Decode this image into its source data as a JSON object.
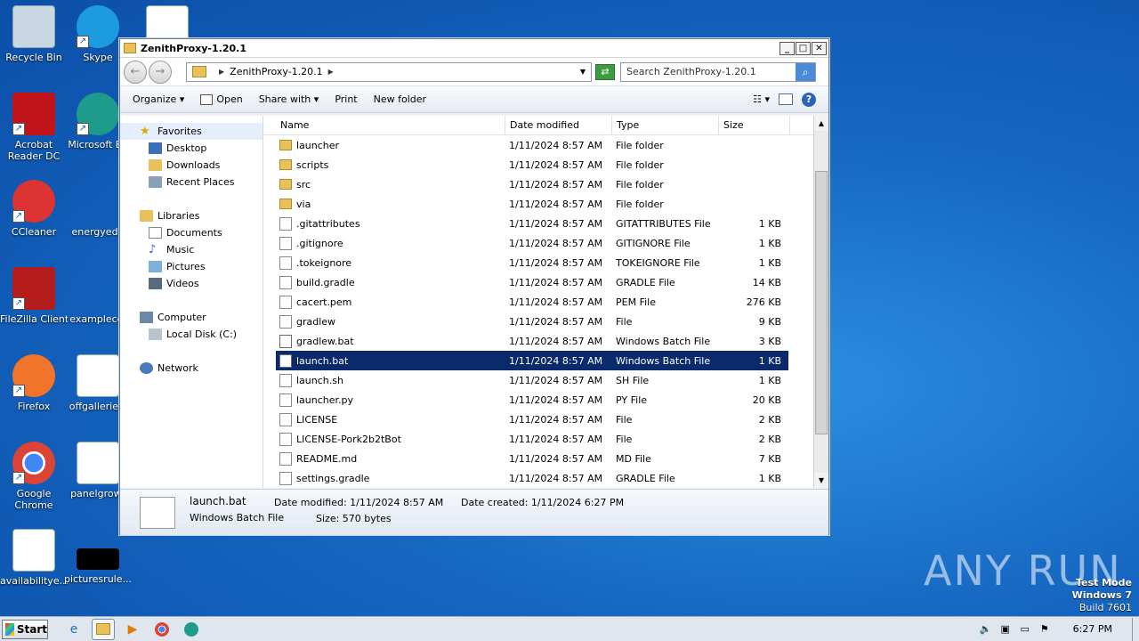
{
  "desktop": {
    "icons": [
      {
        "label": "Recycle Bin"
      },
      {
        "label": "Skype"
      },
      {
        "label": ""
      },
      {
        "label": "Acrobat Reader DC"
      },
      {
        "label": "Microsoft Ed"
      },
      {
        "label": "CCleaner"
      },
      {
        "label": "energyedg"
      },
      {
        "label": "FileZilla Client"
      },
      {
        "label": "exampleco."
      },
      {
        "label": "Firefox"
      },
      {
        "label": "offgalleries."
      },
      {
        "label": "Google Chrome"
      },
      {
        "label": "panelgrowt"
      },
      {
        "label": "availabilitye..."
      },
      {
        "label": "picturesrule..."
      }
    ]
  },
  "window": {
    "title": "ZenithProxy-1.20.1",
    "address": "ZenithProxy-1.20.1",
    "search_placeholder": "Search ZenithProxy-1.20.1",
    "controls": {
      "minimize": "_",
      "maximize": "□",
      "close": "✕"
    }
  },
  "toolbar": {
    "organize": "Organize ▾",
    "open": "Open",
    "share": "Share with ▾",
    "print": "Print",
    "new_folder": "New folder"
  },
  "navpane": {
    "favorites": "Favorites",
    "desktop": "Desktop",
    "downloads": "Downloads",
    "recent": "Recent Places",
    "libraries": "Libraries",
    "documents": "Documents",
    "music": "Music",
    "pictures": "Pictures",
    "videos": "Videos",
    "computer": "Computer",
    "localdisk": "Local Disk (C:)",
    "network": "Network"
  },
  "columns": {
    "name": "Name",
    "date": "Date modified",
    "type": "Type",
    "size": "Size"
  },
  "files": [
    {
      "name": "launcher",
      "date": "1/11/2024 8:57 AM",
      "type": "File folder",
      "size": "",
      "icon": "folder"
    },
    {
      "name": "scripts",
      "date": "1/11/2024 8:57 AM",
      "type": "File folder",
      "size": "",
      "icon": "folder"
    },
    {
      "name": "src",
      "date": "1/11/2024 8:57 AM",
      "type": "File folder",
      "size": "",
      "icon": "folder"
    },
    {
      "name": "via",
      "date": "1/11/2024 8:57 AM",
      "type": "File folder",
      "size": "",
      "icon": "folder"
    },
    {
      "name": ".gitattributes",
      "date": "1/11/2024 8:57 AM",
      "type": "GITATTRIBUTES File",
      "size": "1 KB",
      "icon": "doc"
    },
    {
      "name": ".gitignore",
      "date": "1/11/2024 8:57 AM",
      "type": "GITIGNORE File",
      "size": "1 KB",
      "icon": "doc"
    },
    {
      "name": ".tokeignore",
      "date": "1/11/2024 8:57 AM",
      "type": "TOKEIGNORE File",
      "size": "1 KB",
      "icon": "doc"
    },
    {
      "name": "build.gradle",
      "date": "1/11/2024 8:57 AM",
      "type": "GRADLE File",
      "size": "14 KB",
      "icon": "doc"
    },
    {
      "name": "cacert.pem",
      "date": "1/11/2024 8:57 AM",
      "type": "PEM File",
      "size": "276 KB",
      "icon": "doc"
    },
    {
      "name": "gradlew",
      "date": "1/11/2024 8:57 AM",
      "type": "File",
      "size": "9 KB",
      "icon": "doc"
    },
    {
      "name": "gradlew.bat",
      "date": "1/11/2024 8:57 AM",
      "type": "Windows Batch File",
      "size": "3 KB",
      "icon": "bat"
    },
    {
      "name": "launch.bat",
      "date": "1/11/2024 8:57 AM",
      "type": "Windows Batch File",
      "size": "1 KB",
      "icon": "bat",
      "selected": true
    },
    {
      "name": "launch.sh",
      "date": "1/11/2024 8:57 AM",
      "type": "SH File",
      "size": "1 KB",
      "icon": "doc"
    },
    {
      "name": "launcher.py",
      "date": "1/11/2024 8:57 AM",
      "type": "PY File",
      "size": "20 KB",
      "icon": "doc"
    },
    {
      "name": "LICENSE",
      "date": "1/11/2024 8:57 AM",
      "type": "File",
      "size": "2 KB",
      "icon": "doc"
    },
    {
      "name": "LICENSE-Pork2b2tBot",
      "date": "1/11/2024 8:57 AM",
      "type": "File",
      "size": "2 KB",
      "icon": "doc"
    },
    {
      "name": "README.md",
      "date": "1/11/2024 8:57 AM",
      "type": "MD File",
      "size": "7 KB",
      "icon": "doc"
    },
    {
      "name": "settings.gradle",
      "date": "1/11/2024 8:57 AM",
      "type": "GRADLE File",
      "size": "1 KB",
      "icon": "doc"
    }
  ],
  "details": {
    "name": "launch.bat",
    "type": "Windows Batch File",
    "modified": "Date modified: 1/11/2024 8:57 AM",
    "created": "Date created: 1/11/2024 6:27 PM",
    "size": "Size: 570 bytes"
  },
  "taskbar": {
    "start": "Start",
    "clock": "6:27 PM"
  },
  "watermark": {
    "line1": "Test Mode",
    "line2": "Windows 7",
    "line3": "Build 7601",
    "brand": "ANY RUN"
  }
}
